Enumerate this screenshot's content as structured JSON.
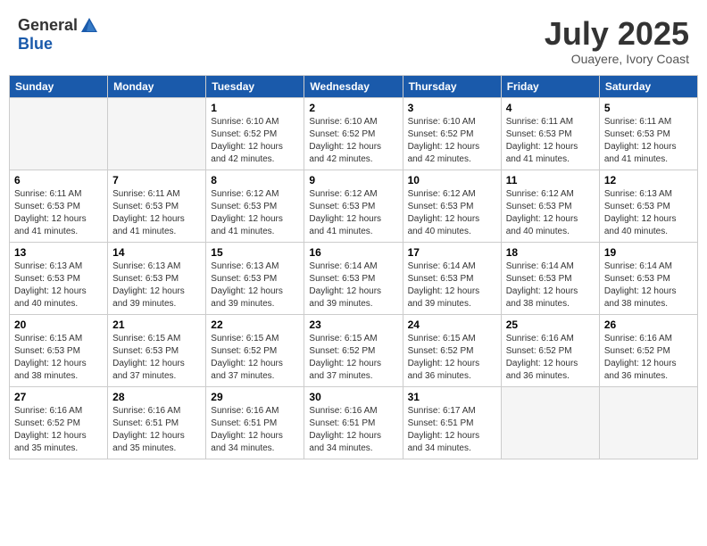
{
  "logo": {
    "text_general": "General",
    "text_blue": "Blue"
  },
  "header": {
    "month": "July 2025",
    "location": "Ouayere, Ivory Coast"
  },
  "weekdays": [
    "Sunday",
    "Monday",
    "Tuesday",
    "Wednesday",
    "Thursday",
    "Friday",
    "Saturday"
  ],
  "weeks": [
    [
      {
        "day": "",
        "sunrise": "",
        "sunset": "",
        "daylight": "",
        "empty": true
      },
      {
        "day": "",
        "sunrise": "",
        "sunset": "",
        "daylight": "",
        "empty": true
      },
      {
        "day": "1",
        "sunrise": "Sunrise: 6:10 AM",
        "sunset": "Sunset: 6:52 PM",
        "daylight": "Daylight: 12 hours and 42 minutes."
      },
      {
        "day": "2",
        "sunrise": "Sunrise: 6:10 AM",
        "sunset": "Sunset: 6:52 PM",
        "daylight": "Daylight: 12 hours and 42 minutes."
      },
      {
        "day": "3",
        "sunrise": "Sunrise: 6:10 AM",
        "sunset": "Sunset: 6:52 PM",
        "daylight": "Daylight: 12 hours and 42 minutes."
      },
      {
        "day": "4",
        "sunrise": "Sunrise: 6:11 AM",
        "sunset": "Sunset: 6:53 PM",
        "daylight": "Daylight: 12 hours and 41 minutes."
      },
      {
        "day": "5",
        "sunrise": "Sunrise: 6:11 AM",
        "sunset": "Sunset: 6:53 PM",
        "daylight": "Daylight: 12 hours and 41 minutes."
      }
    ],
    [
      {
        "day": "6",
        "sunrise": "Sunrise: 6:11 AM",
        "sunset": "Sunset: 6:53 PM",
        "daylight": "Daylight: 12 hours and 41 minutes."
      },
      {
        "day": "7",
        "sunrise": "Sunrise: 6:11 AM",
        "sunset": "Sunset: 6:53 PM",
        "daylight": "Daylight: 12 hours and 41 minutes."
      },
      {
        "day": "8",
        "sunrise": "Sunrise: 6:12 AM",
        "sunset": "Sunset: 6:53 PM",
        "daylight": "Daylight: 12 hours and 41 minutes."
      },
      {
        "day": "9",
        "sunrise": "Sunrise: 6:12 AM",
        "sunset": "Sunset: 6:53 PM",
        "daylight": "Daylight: 12 hours and 41 minutes."
      },
      {
        "day": "10",
        "sunrise": "Sunrise: 6:12 AM",
        "sunset": "Sunset: 6:53 PM",
        "daylight": "Daylight: 12 hours and 40 minutes."
      },
      {
        "day": "11",
        "sunrise": "Sunrise: 6:12 AM",
        "sunset": "Sunset: 6:53 PM",
        "daylight": "Daylight: 12 hours and 40 minutes."
      },
      {
        "day": "12",
        "sunrise": "Sunrise: 6:13 AM",
        "sunset": "Sunset: 6:53 PM",
        "daylight": "Daylight: 12 hours and 40 minutes."
      }
    ],
    [
      {
        "day": "13",
        "sunrise": "Sunrise: 6:13 AM",
        "sunset": "Sunset: 6:53 PM",
        "daylight": "Daylight: 12 hours and 40 minutes."
      },
      {
        "day": "14",
        "sunrise": "Sunrise: 6:13 AM",
        "sunset": "Sunset: 6:53 PM",
        "daylight": "Daylight: 12 hours and 39 minutes."
      },
      {
        "day": "15",
        "sunrise": "Sunrise: 6:13 AM",
        "sunset": "Sunset: 6:53 PM",
        "daylight": "Daylight: 12 hours and 39 minutes."
      },
      {
        "day": "16",
        "sunrise": "Sunrise: 6:14 AM",
        "sunset": "Sunset: 6:53 PM",
        "daylight": "Daylight: 12 hours and 39 minutes."
      },
      {
        "day": "17",
        "sunrise": "Sunrise: 6:14 AM",
        "sunset": "Sunset: 6:53 PM",
        "daylight": "Daylight: 12 hours and 39 minutes."
      },
      {
        "day": "18",
        "sunrise": "Sunrise: 6:14 AM",
        "sunset": "Sunset: 6:53 PM",
        "daylight": "Daylight: 12 hours and 38 minutes."
      },
      {
        "day": "19",
        "sunrise": "Sunrise: 6:14 AM",
        "sunset": "Sunset: 6:53 PM",
        "daylight": "Daylight: 12 hours and 38 minutes."
      }
    ],
    [
      {
        "day": "20",
        "sunrise": "Sunrise: 6:15 AM",
        "sunset": "Sunset: 6:53 PM",
        "daylight": "Daylight: 12 hours and 38 minutes."
      },
      {
        "day": "21",
        "sunrise": "Sunrise: 6:15 AM",
        "sunset": "Sunset: 6:53 PM",
        "daylight": "Daylight: 12 hours and 37 minutes."
      },
      {
        "day": "22",
        "sunrise": "Sunrise: 6:15 AM",
        "sunset": "Sunset: 6:52 PM",
        "daylight": "Daylight: 12 hours and 37 minutes."
      },
      {
        "day": "23",
        "sunrise": "Sunrise: 6:15 AM",
        "sunset": "Sunset: 6:52 PM",
        "daylight": "Daylight: 12 hours and 37 minutes."
      },
      {
        "day": "24",
        "sunrise": "Sunrise: 6:15 AM",
        "sunset": "Sunset: 6:52 PM",
        "daylight": "Daylight: 12 hours and 36 minutes."
      },
      {
        "day": "25",
        "sunrise": "Sunrise: 6:16 AM",
        "sunset": "Sunset: 6:52 PM",
        "daylight": "Daylight: 12 hours and 36 minutes."
      },
      {
        "day": "26",
        "sunrise": "Sunrise: 6:16 AM",
        "sunset": "Sunset: 6:52 PM",
        "daylight": "Daylight: 12 hours and 36 minutes."
      }
    ],
    [
      {
        "day": "27",
        "sunrise": "Sunrise: 6:16 AM",
        "sunset": "Sunset: 6:52 PM",
        "daylight": "Daylight: 12 hours and 35 minutes."
      },
      {
        "day": "28",
        "sunrise": "Sunrise: 6:16 AM",
        "sunset": "Sunset: 6:51 PM",
        "daylight": "Daylight: 12 hours and 35 minutes."
      },
      {
        "day": "29",
        "sunrise": "Sunrise: 6:16 AM",
        "sunset": "Sunset: 6:51 PM",
        "daylight": "Daylight: 12 hours and 34 minutes."
      },
      {
        "day": "30",
        "sunrise": "Sunrise: 6:16 AM",
        "sunset": "Sunset: 6:51 PM",
        "daylight": "Daylight: 12 hours and 34 minutes."
      },
      {
        "day": "31",
        "sunrise": "Sunrise: 6:17 AM",
        "sunset": "Sunset: 6:51 PM",
        "daylight": "Daylight: 12 hours and 34 minutes."
      },
      {
        "day": "",
        "sunrise": "",
        "sunset": "",
        "daylight": "",
        "empty": true
      },
      {
        "day": "",
        "sunrise": "",
        "sunset": "",
        "daylight": "",
        "empty": true
      }
    ]
  ]
}
